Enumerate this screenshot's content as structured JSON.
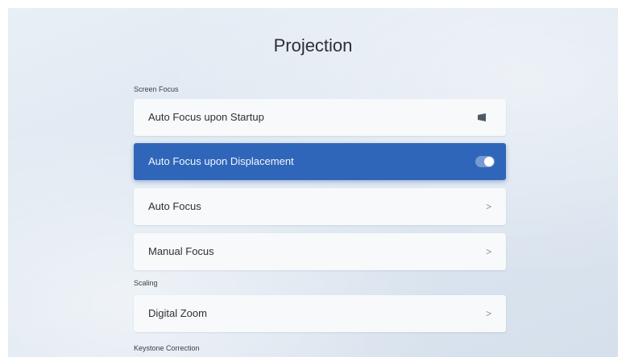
{
  "title": "Projection",
  "sections": {
    "screen_focus": "Screen Focus",
    "scaling": "Scaling",
    "keystone": "Keystone Correction"
  },
  "items": [
    {
      "label": "Auto Focus upon Startup",
      "control": "toggle",
      "state": "off"
    },
    {
      "label": "Auto Focus upon Displacement",
      "control": "toggle",
      "state": "on",
      "selected": true
    },
    {
      "label": "Auto Focus",
      "control": "chevron",
      "glyph": ">"
    },
    {
      "label": "Manual Focus",
      "control": "chevron",
      "glyph": ">"
    },
    {
      "label": "Digital Zoom",
      "control": "chevron",
      "glyph": ">"
    }
  ],
  "colors": {
    "accent": "#2f66b9",
    "row_background": "#f7f9fb",
    "text": "#2d3138"
  }
}
